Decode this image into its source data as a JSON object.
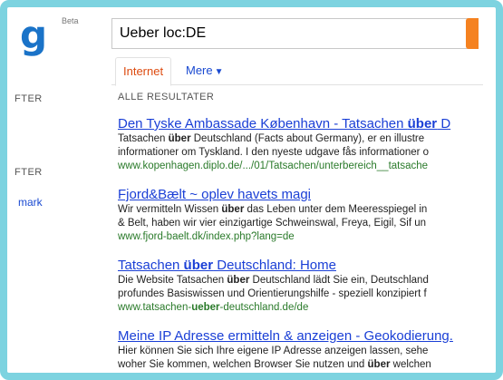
{
  "header": {
    "logo_letter": "g",
    "logo_badge": "Beta",
    "search_value": "Ueber loc:DE"
  },
  "tabs": {
    "internet": "Internet",
    "more": "Mere"
  },
  "sidebar": {
    "label_1": "FTER",
    "label_2": "FTER",
    "link_1": "mark"
  },
  "results_header": "ALLE RESULTATER",
  "results": [
    {
      "title_pre": "Den Tyske Ambassade København - Tatsachen ",
      "title_bold": "über",
      "title_post": " D",
      "line1_pre": "Tatsachen ",
      "line1_bold": "über",
      "line1_post": " Deutschland (Facts about Germany), er en illustre",
      "line2_pre": "informationer om Tyskland. I den nyeste udgave fås informationer o",
      "line2_bold": "",
      "line2_post": "",
      "url_pre": "www.kopenhagen.diplo.de/.../01/Tatsachen/unterbereich__tatsache",
      "url_bold": "",
      "url_post": ""
    },
    {
      "title_pre": "Fjord&Bælt ~ oplev havets magi",
      "title_bold": "",
      "title_post": "",
      "line1_pre": "Wir vermitteln Wissen ",
      "line1_bold": "über",
      "line1_post": " das Leben unter dem Meeresspiegel in",
      "line2_pre": "& Belt, haben wir vier einzigartige Schweinswal, Freya, Eigil, Sif un",
      "line2_bold": "",
      "line2_post": "",
      "url_pre": "www.fjord-baelt.dk/index.php?lang=de",
      "url_bold": "",
      "url_post": ""
    },
    {
      "title_pre": "Tatsachen ",
      "title_bold": "über",
      "title_post": " Deutschland: Home",
      "line1_pre": "Die Website Tatsachen ",
      "line1_bold": "über",
      "line1_post": " Deutschland lädt Sie ein, Deutschland",
      "line2_pre": "profundes Basiswissen und Orientierungshilfe - speziell konzipiert f",
      "line2_bold": "",
      "line2_post": "",
      "url_pre": "www.tatsachen-",
      "url_bold": "ueber",
      "url_post": "-deutschland.de/de"
    },
    {
      "title_pre": "Meine IP Adresse ermitteln & anzeigen - Geokodierung.",
      "title_bold": "",
      "title_post": "",
      "line1_pre": "Hier können Sie sich Ihre eigene IP Adresse anzeigen lassen, sehe",
      "line1_bold": "",
      "line1_post": "",
      "line2_pre": "woher Sie kommen, welchen Browser Sie nutzen und ",
      "line2_bold": "über",
      "line2_post": " welchen",
      "url_pre": "",
      "url_bold": "",
      "url_post": ""
    }
  ],
  "colors": {
    "frame": "#7dd3e0",
    "logo": "#1a73c8",
    "link": "#1a3fd6",
    "url": "#2a7a2a",
    "active_tab": "#dd4b10",
    "search_button": "#f58220"
  }
}
